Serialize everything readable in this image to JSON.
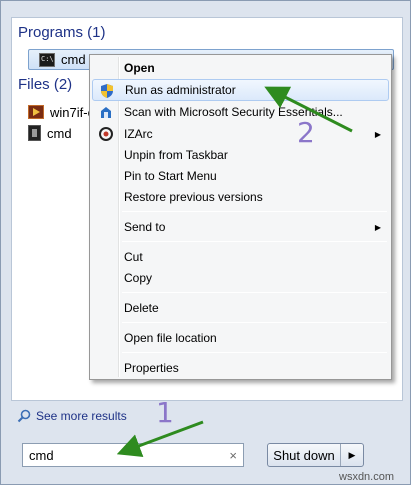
{
  "results": {
    "programs_header": "Programs (1)",
    "programs": [
      {
        "label": "cmd",
        "icon": "cmd-icon"
      }
    ],
    "files_header": "Files (2)",
    "files": [
      {
        "label": "win7if-c",
        "icon": "media-icon"
      },
      {
        "label": "cmd",
        "icon": "film-icon"
      }
    ]
  },
  "context_menu": {
    "items": [
      {
        "label": "Open",
        "bold": true
      },
      {
        "label": "Run as administrator",
        "icon": "uac-shield-icon",
        "highlighted": true
      },
      {
        "label": "Scan with Microsoft Security Essentials...",
        "icon": "security-essentials-icon"
      },
      {
        "label": "IZArc",
        "icon": "izarc-icon",
        "submenu": true
      },
      {
        "label": "Unpin from Taskbar"
      },
      {
        "label": "Pin to Start Menu"
      },
      {
        "label": "Restore previous versions"
      },
      {
        "label": "Send to",
        "submenu": true
      },
      {
        "label": "Cut"
      },
      {
        "label": "Copy"
      },
      {
        "label": "Delete"
      },
      {
        "label": "Open file location"
      },
      {
        "label": "Properties"
      }
    ]
  },
  "see_more": "See more results",
  "search": {
    "value": "cmd",
    "clear": "×"
  },
  "shutdown": {
    "label": "Shut down",
    "arrow": "▶"
  },
  "annotations": {
    "step1": "1",
    "step2": "2"
  },
  "watermark": "wsxdn.com",
  "colors": {
    "accent": "#1e3287",
    "arrow": "#2e8b1f",
    "annotation": "#8b76c9"
  }
}
